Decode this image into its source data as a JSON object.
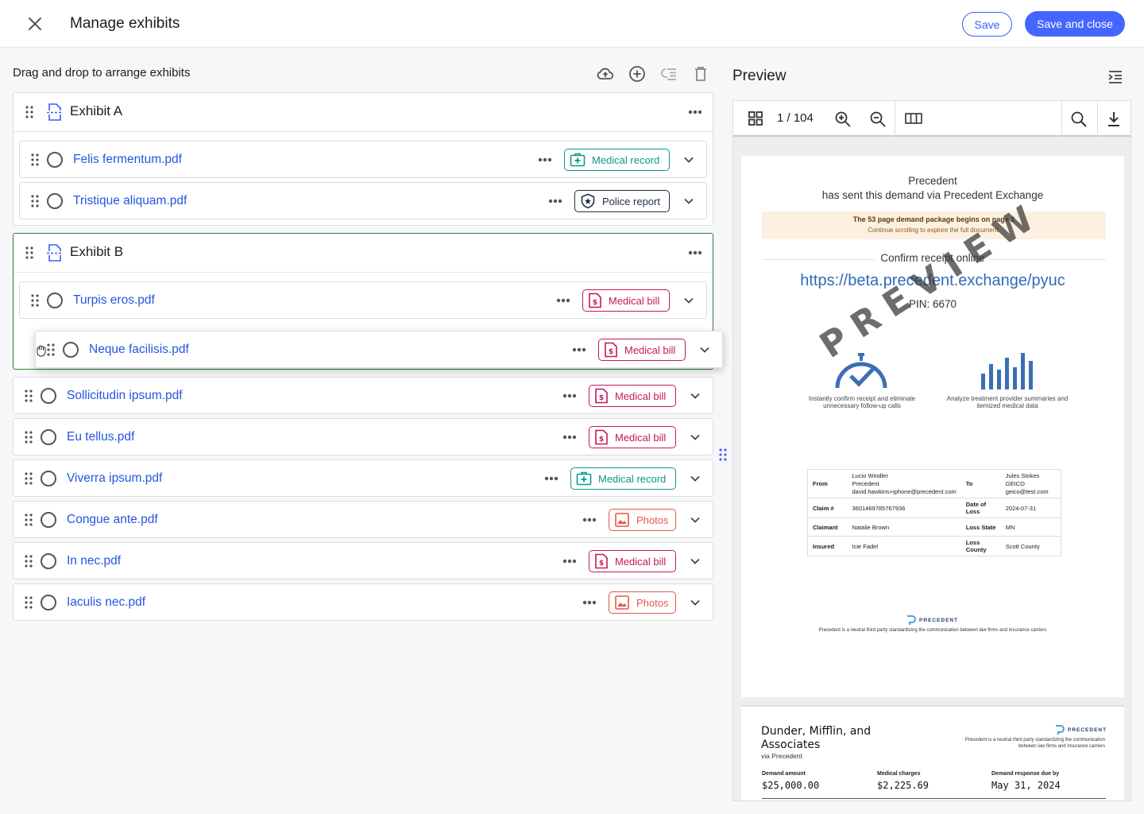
{
  "header": {
    "title": "Manage exhibits",
    "save_label": "Save",
    "save_close_label": "Save and close"
  },
  "left": {
    "heading": "Drag and drop to arrange exhibits",
    "toolbar_icons": [
      "cloud-upload-icon",
      "add-circle-icon",
      "list-indent-icon",
      "trash-icon"
    ]
  },
  "exhibits": [
    {
      "title": "Exhibit A",
      "files": [
        {
          "name": "Felis fermentum.pdf",
          "tag": "Medical record"
        },
        {
          "name": "Tristique aliquam.pdf",
          "tag": "Police report"
        }
      ]
    },
    {
      "title": "Exhibit B",
      "files": [
        {
          "name": "Turpis eros.pdf",
          "tag": "Medical bill"
        }
      ]
    }
  ],
  "dragging_file": {
    "name": "Neque facilisis.pdf",
    "tag": "Medical bill"
  },
  "loose_files": [
    {
      "name": "Sollicitudin ipsum.pdf",
      "tag": "Medical bill"
    },
    {
      "name": "Eu tellus.pdf",
      "tag": "Medical bill"
    },
    {
      "name": "Viverra ipsum.pdf",
      "tag": "Medical record"
    },
    {
      "name": "Congue ante.pdf",
      "tag": "Photos"
    },
    {
      "name": "In nec.pdf",
      "tag": "Medical bill"
    },
    {
      "name": "Iaculis nec.pdf",
      "tag": "Photos"
    }
  ],
  "tag_colors": {
    "Medical record": "#0a9a8a",
    "Police report": "#1f2d4a",
    "Medical bill": "#c2185b",
    "Photos": "#e4574b"
  },
  "preview": {
    "title": "Preview",
    "page_indicator": "1 / 104",
    "page1": {
      "sender": "Precedent",
      "line": "has sent this demand via Precedent Exchange",
      "banner_title": "The 53 page demand package begins on page 2",
      "banner_sub": "Continue scrolling to explore the full document.",
      "confirm": "Confirm receipt online",
      "url": "https://beta.precedent.exchange/pyuc",
      "pin": "PIN: 6670",
      "watermark": "PREVIEW",
      "feature1": "Instantly confirm receipt and eliminate unnecessary follow-up calls",
      "feature2": "Analyze treatment provider summaries and itemized medical data",
      "table": {
        "from_k": "From",
        "from_v": "Lucio Windler\nPrecedent\ndavid.hawkins+iphone@precedent.com",
        "to_k": "To",
        "to_v": "Jules Stokes\nGEICO\ngeico@test.com",
        "claim_k": "Claim #",
        "claim_v": "3601469785767936",
        "dol_k": "Date of Loss",
        "dol_v": "2024-07-31",
        "claimant_k": "Claimant",
        "claimant_v": "Natalie Brown",
        "state_k": "Loss State",
        "state_v": "MN",
        "insured_k": "Insured",
        "insured_v": "Icie Fadel",
        "county_k": "Loss County",
        "county_v": "Scott County"
      },
      "brand": "PRECEDENT",
      "footer": "Precedent is a neutral third party standardizing the communication between law firms and insurance carriers"
    },
    "page2": {
      "firm": "Dunder, Mifflin, and Associates",
      "via": "via Precedent",
      "brand": "PRECEDENT",
      "brand_sub": "Precedent is a neutral third party standardizing the communication between law firms and insurance carriers",
      "demand_k": "Demand amount",
      "demand_v": "$25,000.00",
      "charges_k": "Medical charges",
      "charges_v": "$2,225.69",
      "due_k": "Demand response due by",
      "due_v": "May 31, 2024"
    }
  }
}
